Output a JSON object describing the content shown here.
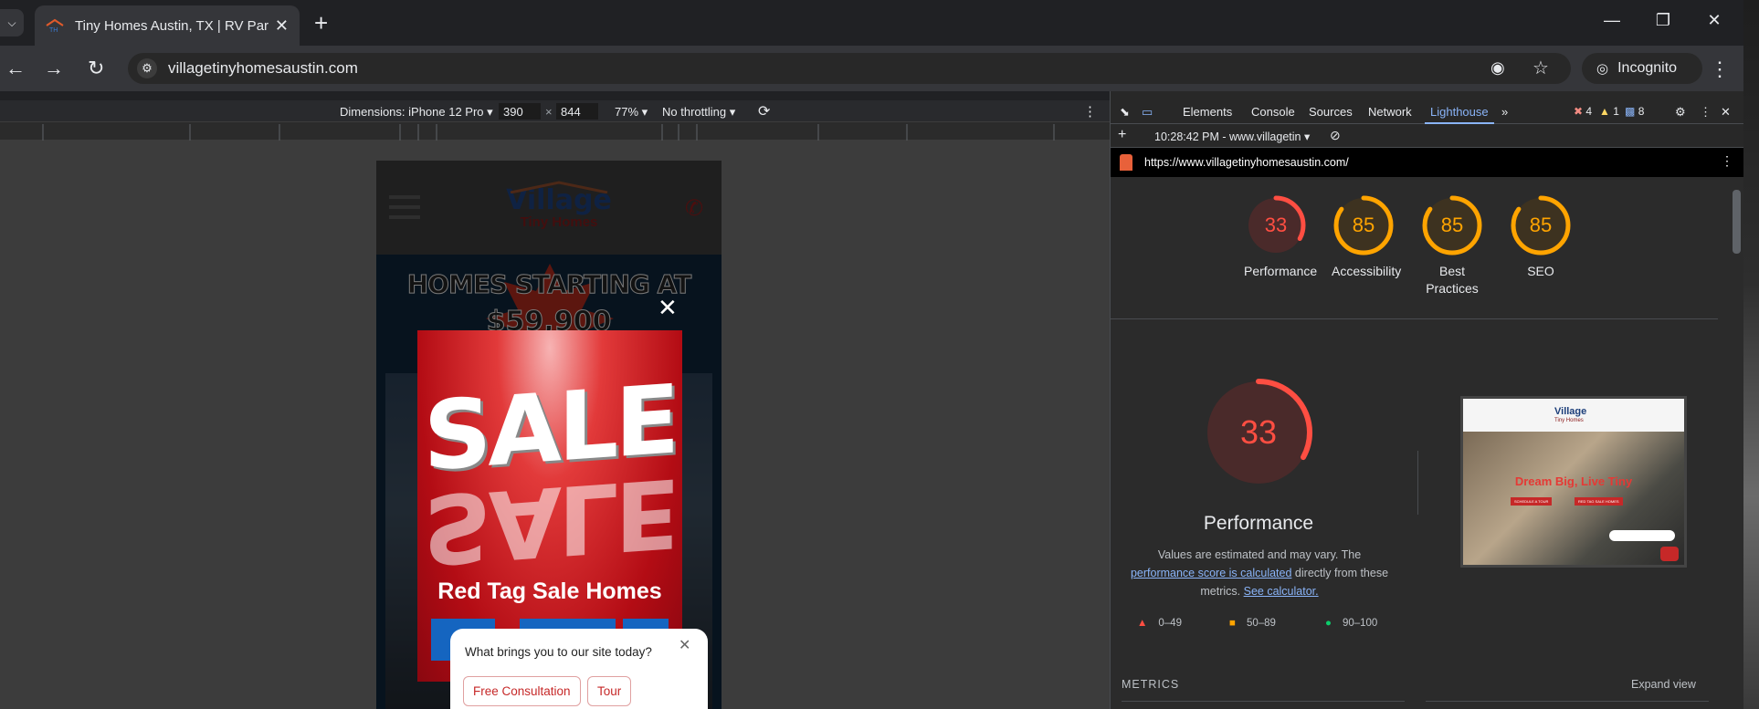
{
  "tab": {
    "title": "Tiny Homes Austin, TX | RV Park"
  },
  "omnibox": {
    "url": "villagetinyhomesaustin.com"
  },
  "incognito_label": "Incognito",
  "device_toolbar": {
    "dimensions_label": "Dimensions: iPhone 12 Pro",
    "width": "390",
    "height": "844",
    "zoom": "77%",
    "throttling": "No throttling"
  },
  "phone": {
    "logo_top": "Village",
    "logo_bottom": "Tiny Homes",
    "banner_line1": "HOMES STARTING AT",
    "banner_line2": "$59,900",
    "sale_big": "SALE",
    "sale_title": "Red Tag Sale Homes",
    "chat_question": "What brings you to our site today?",
    "chat_options": [
      "Free Consultation",
      "Tour"
    ]
  },
  "devtools": {
    "tabs": [
      "Elements",
      "Console",
      "Sources",
      "Network",
      "Lighthouse"
    ],
    "active_tab": "Lighthouse",
    "errors": "4",
    "warnings": "1",
    "messages": "8",
    "report_time": "10:28:42 PM - www.villagetin",
    "report_url": "https://www.villagetinyhomesaustin.com/"
  },
  "lighthouse": {
    "scores": [
      {
        "label": "Performance",
        "value": 33,
        "color": "#ff4e42"
      },
      {
        "label": "Accessibility",
        "value": 85,
        "color": "#ffa400"
      },
      {
        "label": "Best Practices",
        "value": 85,
        "color": "#ffa400"
      },
      {
        "label": "SEO",
        "value": 85,
        "color": "#ffa400"
      }
    ],
    "main_score": 33,
    "main_label": "Performance",
    "desc_1": "Values are estimated and may vary. The",
    "desc_link_1": "performance score is calculated",
    "desc_2": "directly from these metrics.",
    "desc_link_2": "See calculator.",
    "legend": [
      "0–49",
      "50–89",
      "90–100"
    ],
    "thumb_headline": "Dream Big, Live Tiny",
    "thumb_btn1": "SCHEDULE A TOUR",
    "thumb_btn2": "RED TAG SALE HOMES",
    "metrics_label": "METRICS",
    "expand_view": "Expand view"
  }
}
